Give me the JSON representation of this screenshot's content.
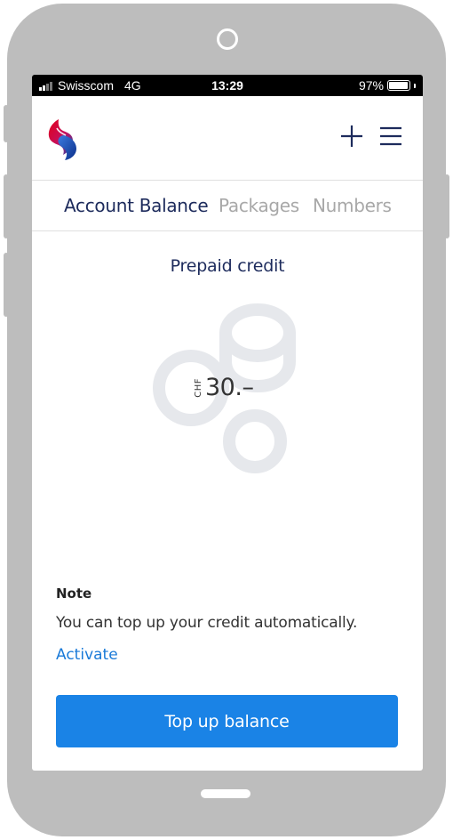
{
  "status_bar": {
    "carrier": "Swisscom",
    "network": "4G",
    "time": "13:29",
    "battery": "97%",
    "battery_level": 0.97
  },
  "header": {
    "logo_icon": "swisscom-logo-icon",
    "add_icon": "plus-icon",
    "menu_icon": "hamburger-menu-icon"
  },
  "tabs": [
    {
      "label": "Account Balance",
      "active": true
    },
    {
      "label": "Packages",
      "active": false
    },
    {
      "label": "Numbers",
      "active": false
    }
  ],
  "balance": {
    "title": "Prepaid credit",
    "currency": "CHF",
    "amount": "30.–"
  },
  "note": {
    "title": "Note",
    "text": "You can top up your credit automatically.",
    "link": "Activate"
  },
  "actions": {
    "topup_label": "Top up balance"
  },
  "colors": {
    "navy": "#1d2b5c",
    "accent_blue": "#1a83e6",
    "link_blue": "#1a7ad8",
    "inactive_tab": "#a8a8a8",
    "coin_gray": "#e6e8ec",
    "frame_gray": "#bdbdbd"
  }
}
